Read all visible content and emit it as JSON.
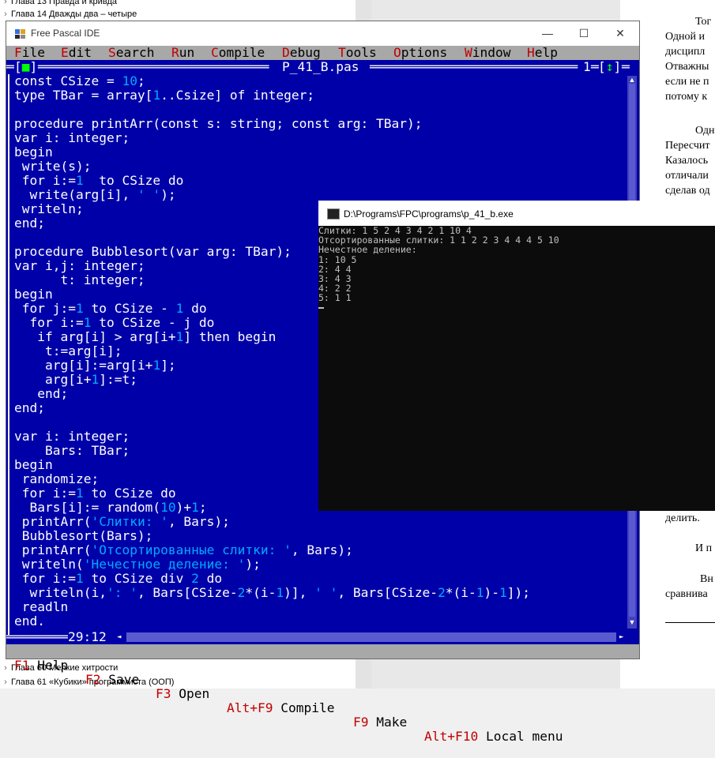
{
  "toc": {
    "top_items": [
      "Глава 13 Правда и кривда",
      "Глава 14 Дважды два – четыре"
    ],
    "bottom_items": [
      "Глава 60 Мелкие хитрости",
      "Глава 61 «Кубики» программиста (ООП)"
    ]
  },
  "document": {
    "lines": [
      "Тог",
      "Одной и",
      "дисципл",
      "Отважны",
      "если не п",
      "потому к",
      "Одн",
      "Пересчит",
      "Казалось",
      "отличали",
      "сделав од",
      "делить.",
      "И п",
      "Вн",
      "сравнива"
    ]
  },
  "ide": {
    "title": "Free Pascal IDE",
    "window_buttons": {
      "minimize": "—",
      "maximize": "☐",
      "close": "✕"
    },
    "menu": [
      {
        "hot": "F",
        "rest": "ile"
      },
      {
        "hot": "E",
        "rest": "dit"
      },
      {
        "hot": "S",
        "rest": "earch"
      },
      {
        "hot": "R",
        "rest": "un"
      },
      {
        "hot": "C",
        "rest": "ompile"
      },
      {
        "hot": "D",
        "rest": "ebug"
      },
      {
        "hot": "T",
        "rest": "ools"
      },
      {
        "hot": "O",
        "rest": "ptions"
      },
      {
        "hot": "W",
        "rest": "indow"
      },
      {
        "hot": "H",
        "rest": "elp"
      }
    ],
    "editor": {
      "filename": "P_41_B.pas",
      "close_box": "[▪]",
      "window_number": "1",
      "resize_box": "[↕]",
      "cursor_position": "29:12"
    },
    "code": [
      "const CSize = 10;",
      "type TBar = array[1..Csize] of integer;",
      "",
      "procedure printArr(const s: string; const arg: TBar);",
      "var i: integer;",
      "begin",
      " write(s);",
      " for i:=1  to CSize do",
      "  write(arg[i], ' ');",
      " writeln;",
      "end;",
      "",
      "procedure Bubblesort(var arg: TBar);",
      "var i,j: integer;",
      "      t: integer;",
      "begin",
      " for j:=1 to CSize - 1 do",
      "  for i:=1 to CSize - j do",
      "   if arg[i] > arg[i+1] then begin",
      "    t:=arg[i];",
      "    arg[i]:=arg[i+1];",
      "    arg[i+1]:=t;",
      "   end;",
      "end;",
      "",
      "var i: integer;",
      "    Bars: TBar;",
      "begin",
      " randomize;",
      " for i:=1 to CSize do",
      "  Bars[i]:= random(10)+1;",
      " printArr('Слитки: ', Bars);",
      " Bubblesort(Bars);",
      " printArr('Отсортированные слитки: ', Bars);",
      " writeln('Нечестное деление: ');",
      " for i:=1 to CSize div 2 do",
      "  writeln(i,': ', Bars[CSize-2*(i-1)], ' ', Bars[CSize-2*(i-1)-1]);",
      " readln",
      "end."
    ],
    "status": [
      {
        "key": "F1",
        "label": "Help"
      },
      {
        "key": "F2",
        "label": "Save"
      },
      {
        "key": "F3",
        "label": "Open"
      },
      {
        "key": "Alt+F9",
        "label": "Compile"
      },
      {
        "key": "F9",
        "label": "Make"
      },
      {
        "key": "Alt+F10",
        "label": "Local menu"
      }
    ]
  },
  "console": {
    "title": "D:\\Programs\\FPC\\programs\\p_41_b.exe",
    "lines": [
      "Слитки: 1 5 2 4 3 4 2 1 10 4",
      "Отсортированные слитки: 1 1 2 2 3 4 4 4 5 10",
      "Нечестное деление:",
      "1: 10 5",
      "2: 4 4",
      "3: 4 3",
      "4: 2 2",
      "5: 1 1"
    ]
  },
  "colors": {
    "ide_background": "#0000a8",
    "menu_background": "#a8a8a8",
    "hotkey": "#c00000",
    "literal": "#00aaff",
    "console_background": "#0c0c0c"
  }
}
